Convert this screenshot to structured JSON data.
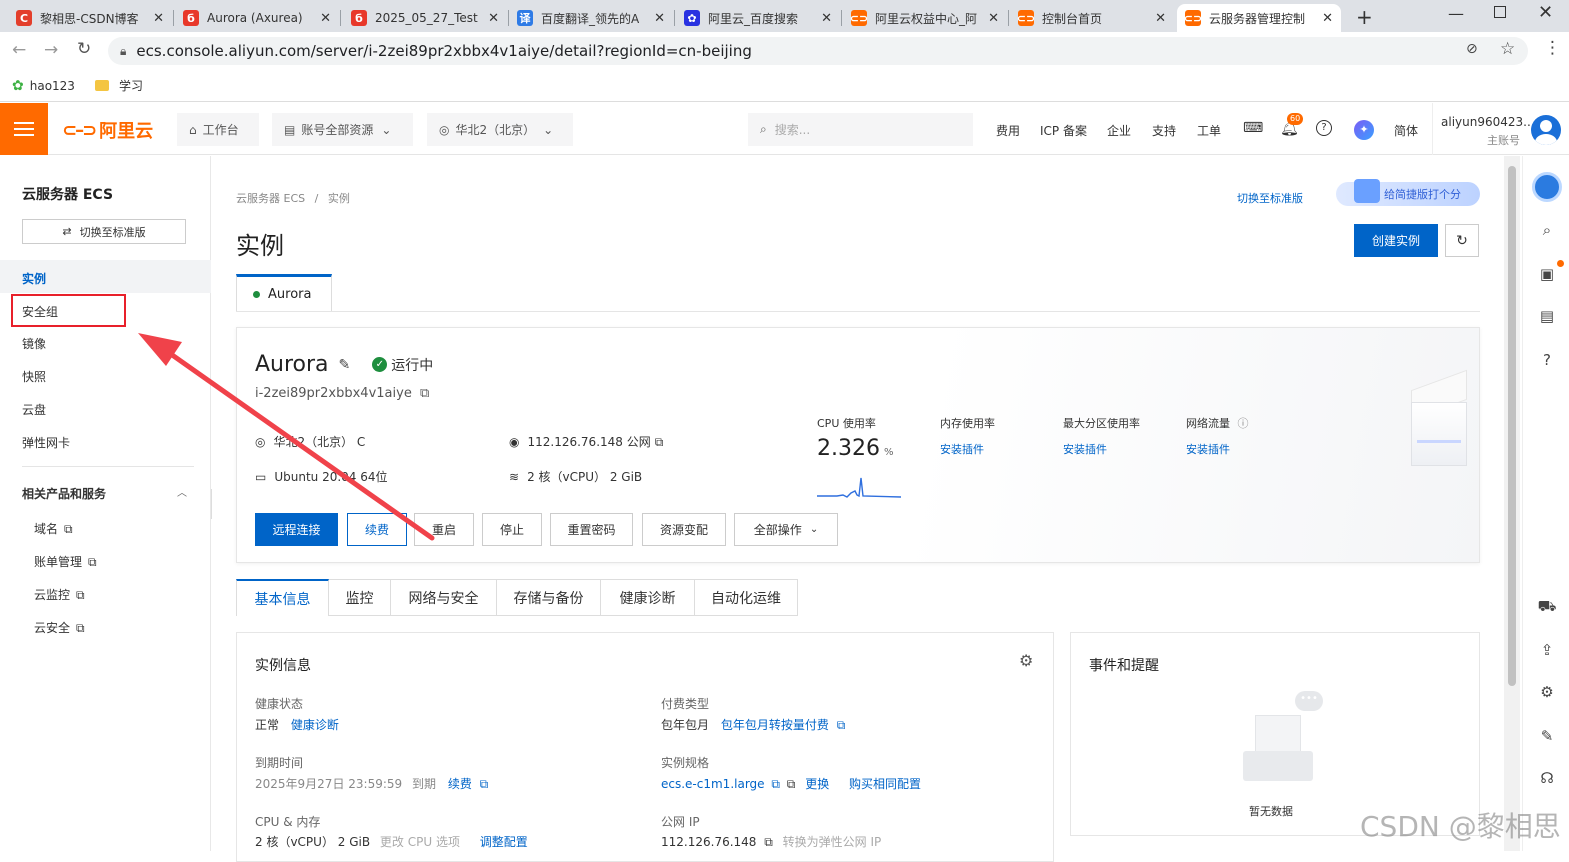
{
  "browser": {
    "tabs": [
      {
        "title": "黎相思-CSDN博客",
        "fav_color": "#e33e2b",
        "fav_glyph": "C"
      },
      {
        "title": "Aurora (Axurea)",
        "fav_color": "#e8382a",
        "fav_glyph": "б"
      },
      {
        "title": "2025_05_27_Test",
        "fav_color": "#e8382a",
        "fav_glyph": "б"
      },
      {
        "title": "百度翻译_领先的A",
        "fav_color": "#2e7be6",
        "fav_glyph": "译"
      },
      {
        "title": "阿里云_百度搜索",
        "fav_color": "#2932e1",
        "fav_glyph": "✿"
      },
      {
        "title": "阿里云权益中心_阿",
        "fav_color": "#ff6a00",
        "fav_glyph": "⊂⊃"
      },
      {
        "title": "控制台首页",
        "fav_color": "#ff6a00",
        "fav_glyph": "⊂⊃"
      },
      {
        "title": "云服务器管理控制",
        "fav_color": "#ff6a00",
        "fav_glyph": "⊂⊃"
      }
    ],
    "url": "ecs.console.aliyun.com/server/i-2zei89pr2xbbx4v1aiye/detail?regionId=cn-beijing",
    "bookmarks": [
      {
        "label": "hao123"
      },
      {
        "label": "学习"
      }
    ]
  },
  "topnav": {
    "logo": "阿里云",
    "workbench": "工作台",
    "resources": "账号全部资源",
    "region": "华北2（北京）",
    "search_placeholder": "搜索...",
    "links": [
      "费用",
      "ICP 备案",
      "企业",
      "支持",
      "工单"
    ],
    "bell_badge": "60",
    "lang": "简体",
    "user": "aliyun960423...",
    "user_sub": "主账号"
  },
  "sidebar": {
    "title": "云服务器 ECS",
    "switch_btn": "切换至标准版",
    "items": [
      "实例",
      "安全组",
      "镜像",
      "快照",
      "云盘",
      "弹性网卡"
    ],
    "related_title": "相关产品和服务",
    "related": [
      "域名",
      "账单管理",
      "云监控",
      "云安全"
    ]
  },
  "main": {
    "breadcrumb": [
      "云服务器 ECS",
      "实例"
    ],
    "switch_std": "切换至标准版",
    "feedback": "给简捷版打个分",
    "page_title": "实例",
    "create_btn": "创建实例",
    "instance_tab": "Aurora",
    "instance": {
      "name": "Aurora",
      "status": "运行中",
      "id": "i-2zei89pr2xbbx4v1aiye",
      "zone": "华北2（北京） C",
      "ip": "112.126.76.148 公网",
      "os": "Ubuntu 20.04 64位",
      "spec": "2 核（vCPU） 2 GiB"
    },
    "metrics": {
      "cpu_label": "CPU 使用率",
      "cpu_value": "2.326",
      "cpu_unit": "%",
      "mem_label": "内存使用率",
      "disk_label": "最大分区使用率",
      "net_label": "网络流量",
      "install": "安装插件"
    },
    "actions": [
      "远程连接",
      "续费",
      "重启",
      "停止",
      "重置密码",
      "资源变配",
      "全部操作"
    ],
    "tabs": [
      "基本信息",
      "监控",
      "网络与安全",
      "存储与备份",
      "健康诊断",
      "自动化运维"
    ],
    "info": {
      "title": "实例信息",
      "health_label": "健康状态",
      "health_value": "正常",
      "health_link": "健康诊断",
      "pay_label": "付费类型",
      "pay_value": "包年包月",
      "pay_link": "包年包月转按量付费",
      "expire_label": "到期时间",
      "expire_value": "2025年9月27日 23:59:59",
      "expire_suffix": "到期",
      "renew_link": "续费",
      "spec_label": "实例规格",
      "spec_value": "ecs.e-c1m1.large",
      "spec_change": "更换",
      "spec_buy": "购买相同配置",
      "cpu_mem_label": "CPU & 内存",
      "cpu_mem_value": "2 核（vCPU） 2 GiB",
      "cpu_mem_opt": "更改 CPU 选项",
      "cpu_mem_adjust": "调整配置",
      "public_ip_label": "公网 IP",
      "public_ip_value": "112.126.76.148",
      "public_ip_convert": "转换为弹性公网 IP"
    },
    "events": {
      "title": "事件和提醒",
      "empty": "暂无数据"
    }
  },
  "watermark": "CSDN @黎相思"
}
